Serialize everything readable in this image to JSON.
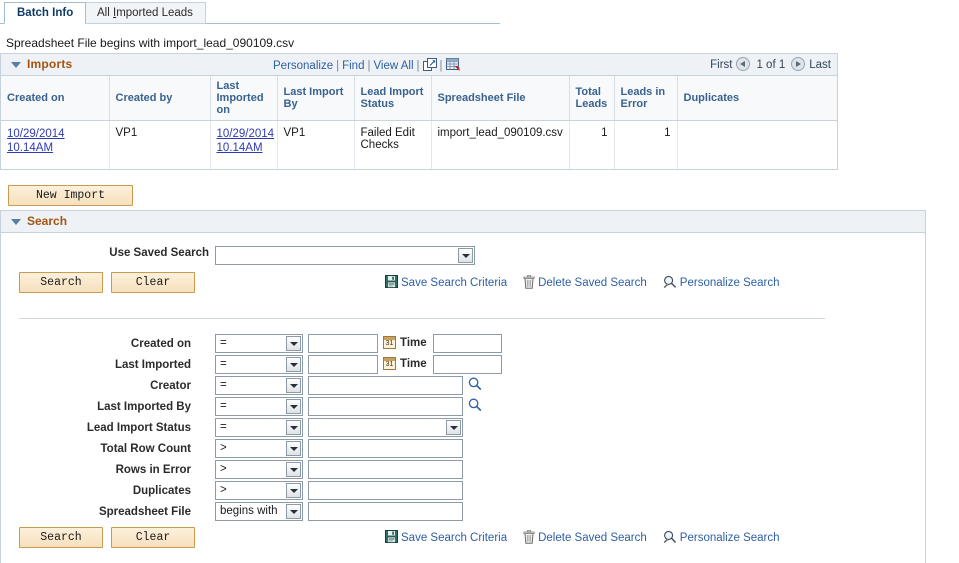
{
  "tabs": [
    {
      "label": "Batch Info",
      "active": true
    },
    {
      "label": "All Imported Leads",
      "active": false,
      "accesskey": "I"
    }
  ],
  "summary_line": "Spreadsheet File begins with import_lead_090109.csv",
  "imports_grid": {
    "title": "Imports",
    "actions": {
      "personalize": "Personalize",
      "find": "Find",
      "view_all": "View All",
      "separator": "|",
      "new_window_icon": "new-window-icon",
      "download_icon": "download-to-spreadsheet-icon"
    },
    "pager": {
      "first": "First",
      "count": "1 of 1",
      "last": "Last",
      "prev_icon": "previous-arrow-icon",
      "next_icon": "next-arrow-icon"
    },
    "columns": [
      "Created on",
      "Created by",
      "Last Imported on",
      "Last Import By",
      "Lead Import Status",
      "Spreadsheet File",
      "Total Leads",
      "Leads in Error",
      "Duplicates"
    ],
    "rows": [
      {
        "created_on_date": "10/29/2014",
        "created_on_time": "10.14AM",
        "created_by": "VP1",
        "last_imported_date": "10/29/2014",
        "last_imported_time": "10.14AM",
        "last_import_by": "VP1",
        "lead_import_status": "Failed Edit Checks",
        "spreadsheet_file": "import_lead_090109.csv",
        "total_leads": "1",
        "leads_in_error": "1",
        "duplicates": ""
      }
    ]
  },
  "new_import_button": "New Import",
  "search_panel": {
    "title": "Search",
    "use_saved_search_label": "Use Saved Search",
    "use_saved_search_value": "",
    "buttons": {
      "search": "Search",
      "clear": "Clear"
    },
    "links": {
      "save_search_criteria": "Save Search Criteria",
      "delete_saved_search": "Delete Saved Search",
      "personalize_search": "Personalize Search",
      "save_icon": "save-floppy-icon",
      "delete_icon": "trash-can-icon",
      "personalize_icon": "personalize-magnifier-icon"
    },
    "criteria": [
      {
        "label": "Created on",
        "operator": "=",
        "value": "",
        "has_calendar": true,
        "time_label": "Time",
        "time_value": ""
      },
      {
        "label": "Last Imported",
        "operator": "=",
        "value": "",
        "has_calendar": true,
        "time_label": "Time",
        "time_value": ""
      },
      {
        "label": "Creator",
        "operator": "=",
        "value": "",
        "has_lookup": true
      },
      {
        "label": "Last Imported By",
        "operator": "=",
        "value": "",
        "has_lookup": true
      },
      {
        "label": "Lead Import Status",
        "operator": "=",
        "value": "",
        "value_is_select": true
      },
      {
        "label": "Total Row Count",
        "operator": ">",
        "value": ""
      },
      {
        "label": "Rows in Error",
        "operator": ">",
        "value": ""
      },
      {
        "label": "Duplicates",
        "operator": ">",
        "value": ""
      },
      {
        "label": "Spreadsheet File",
        "operator": "begins with",
        "value": ""
      }
    ]
  },
  "colors": {
    "section_title": "#a3540f",
    "link": "#2d5fa4",
    "grid_link": "#2f3bb3",
    "column_header": "#39628f",
    "button_face": "#f6e0bd"
  }
}
